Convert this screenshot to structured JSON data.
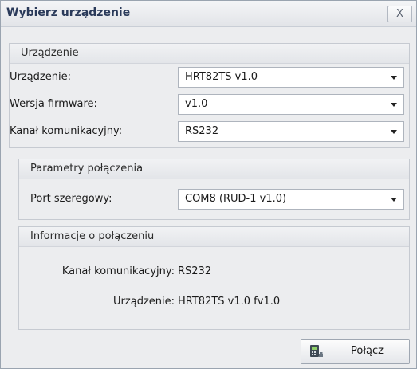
{
  "window": {
    "title": "Wybierz urządzenie",
    "close_label": "X"
  },
  "device_group": {
    "header": "Urządzenie",
    "device_label": "Urządzenie:",
    "device_value": "HRT82TS v1.0",
    "firmware_label": "Wersja firmware:",
    "firmware_value": "v1.0",
    "channel_label": "Kanał komunikacyjny:",
    "channel_value": "RS232"
  },
  "connection_group": {
    "header": "Parametry połączenia",
    "port_label": "Port szeregowy:",
    "port_value": "COM8 (RUD-1 v1.0)"
  },
  "info_group": {
    "header": "Informacje o połączeniu",
    "channel_label": "Kanał komunikacyjny:",
    "channel_value": "RS232",
    "device_label": "Urządzenie:",
    "device_value": "HRT82TS v1.0 fv1.0"
  },
  "footer": {
    "connect_label": "Połącz"
  },
  "icons": {
    "close": "close-icon",
    "dropdown": "chevron-down-icon",
    "connect": "device-connect-icon"
  }
}
